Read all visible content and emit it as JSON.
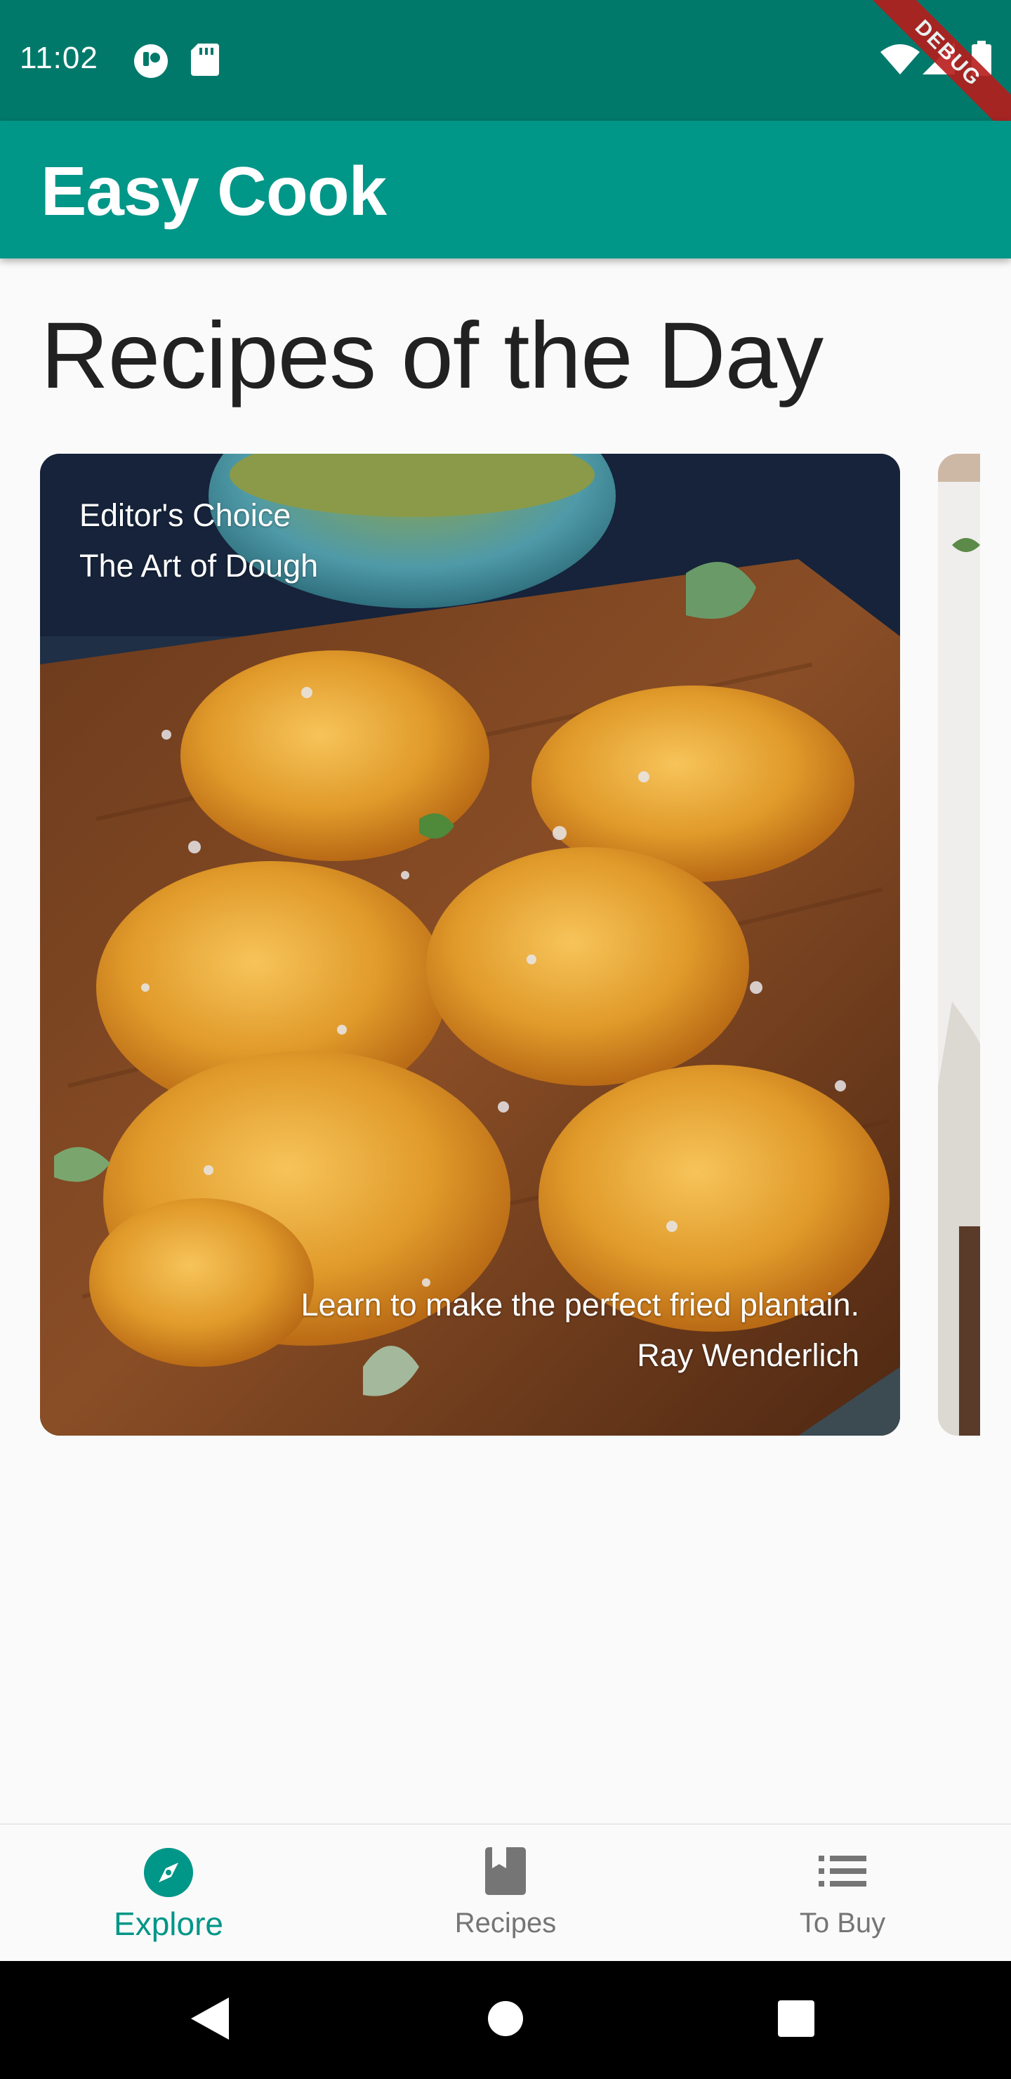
{
  "status_bar": {
    "time": "11:02",
    "icons": [
      "app-notification-icon",
      "sd-card-icon",
      "wifi-icon",
      "signal-icon",
      "battery-icon"
    ],
    "debug_banner": "DEBUG",
    "background": "#00796b"
  },
  "app_bar": {
    "title": "Easy Cook",
    "background": "#009688"
  },
  "main": {
    "heading": "Recipes of the Day",
    "cards": [
      {
        "category": "Editor's Choice",
        "title": "The Art of Dough",
        "description": "Learn to make the perfect fried plantain.",
        "author": "Ray Wenderlich"
      }
    ]
  },
  "bottom_nav": {
    "items": [
      {
        "label": "Explore",
        "icon": "explore-icon",
        "active": true
      },
      {
        "label": "Recipes",
        "icon": "book-icon",
        "active": false
      },
      {
        "label": "To Buy",
        "icon": "list-icon",
        "active": false
      }
    ],
    "active_color": "#009688",
    "inactive_color": "#757575"
  },
  "system_nav": {
    "buttons": [
      "back-icon",
      "home-icon",
      "recents-icon"
    ]
  }
}
